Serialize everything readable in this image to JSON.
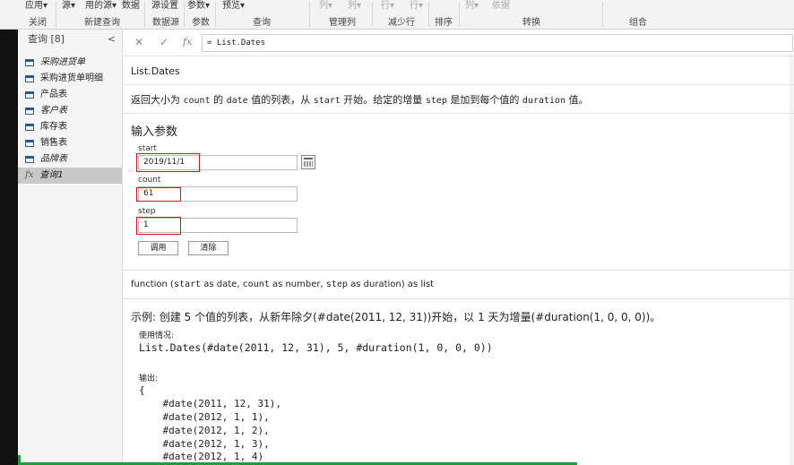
{
  "ribbon": {
    "top": [
      "应用▾",
      "源▾",
      "用的源▾",
      "数据",
      "源设置",
      "参数▾",
      "预览▾",
      "列▾",
      "列▾",
      "行▾",
      "行▾",
      "列▾",
      "依据"
    ],
    "groups": [
      "关闭",
      "新建查询",
      "数据源",
      "参数",
      "查询",
      "管理列",
      "减少行",
      "排序",
      "转换",
      "组合"
    ]
  },
  "queries": {
    "header": "查询 [8]",
    "collapse": "<",
    "items": [
      {
        "label": "采购进货单",
        "italic": true
      },
      {
        "label": "采购进货单明细",
        "italic": false
      },
      {
        "label": "产品表",
        "italic": false
      },
      {
        "label": "客户表",
        "italic": true
      },
      {
        "label": "库存表",
        "italic": false
      },
      {
        "label": "销售表",
        "italic": false
      },
      {
        "label": "品牌表",
        "italic": true
      },
      {
        "label": "查询1",
        "italic": true,
        "selected": true,
        "fx": "fx"
      }
    ]
  },
  "formula_bar": {
    "cancel": "✕",
    "confirm": "✓",
    "fx": "fx",
    "text": "= List.Dates"
  },
  "function_name": "List.Dates",
  "description": {
    "p1": "返回大小为 ",
    "c1": "count",
    "p2": " 的 ",
    "c2": "date",
    "p3": " 值的列表，从 ",
    "c3": "start",
    "p4": " 开始。给定的增量 ",
    "c4": "step",
    "p5": " 是加到每个值的 ",
    "c5": "duration",
    "p6": " 值。"
  },
  "params": {
    "title": "输入参数",
    "start_label": "start",
    "start_value": "2019/11/1",
    "count_label": "count",
    "count_value": "61",
    "step_label": "step",
    "step_value": "1",
    "invoke": "调用",
    "clear": "清除"
  },
  "signature": {
    "p1": "function (",
    "c1": "start",
    "p2": " as date, ",
    "c2": "count",
    "p3": " as number, ",
    "c3": "step",
    "p4": " as duration) as list"
  },
  "example": {
    "title": "示例: 创建 5 个值的列表，从新年除夕(#date(2011, 12, 31))开始，以 1 天为增量(#duration(1, 0, 0, 0))。",
    "usage_label": "使用情况:",
    "usage_code": "List.Dates(#date(2011, 12, 31), 5, #duration(1, 0, 0, 0))",
    "output_label": "输出:",
    "output_lines": [
      "{",
      "    #date(2011, 12, 31),",
      "    #date(2012, 1, 1),",
      "    #date(2012, 1, 2),",
      "    #date(2012, 1, 3),",
      "    #date(2012, 1, 4)"
    ]
  }
}
